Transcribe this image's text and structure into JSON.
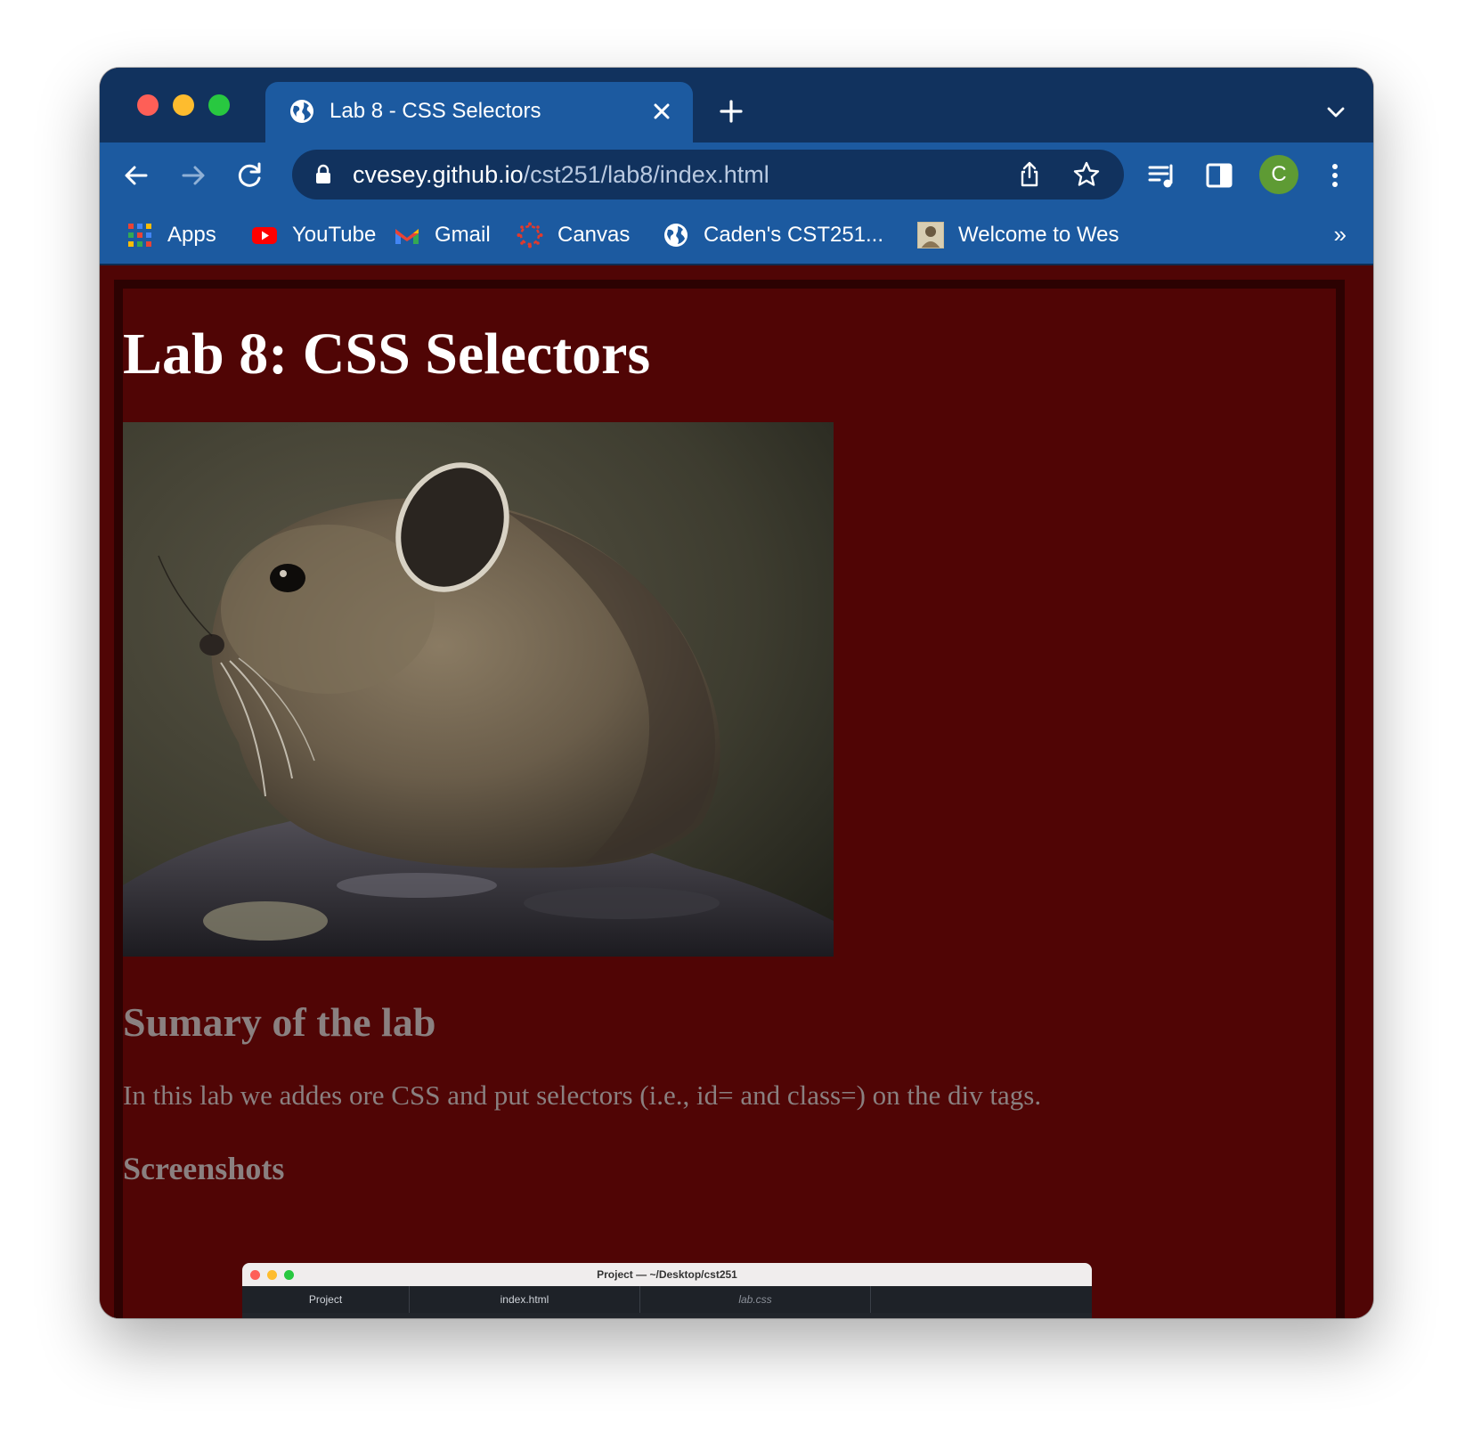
{
  "browser": {
    "tab_title": "Lab 8 - CSS Selectors",
    "url_host": "cvesey.github.io",
    "url_path": "/cst251/lab8/index.html",
    "profile_initial": "C",
    "bookmarks": [
      {
        "label": "Apps",
        "icon": "apps-grid-icon"
      },
      {
        "label": "YouTube",
        "icon": "youtube-icon"
      },
      {
        "label": "Gmail",
        "icon": "gmail-icon"
      },
      {
        "label": "Canvas",
        "icon": "canvas-icon"
      },
      {
        "label": "Caden's CST251...",
        "icon": "globe-icon"
      },
      {
        "label": "Welcome to Wes",
        "icon": "site-thumbnail-icon"
      }
    ],
    "bookmarks_overflow": "»",
    "colors": {
      "tabstrip": "#11325e",
      "toolbar": "#1c5aa0",
      "avatar": "#5e9b34"
    }
  },
  "page": {
    "title": "Lab 8: CSS Selectors",
    "summary_heading": "Sumary of the lab",
    "summary_text": "In this lab we addes ore CSS and put selectors (i.e., id= and class=) on the div tags.",
    "screenshots_heading": "Screenshots",
    "background_color": "#500505",
    "photo_subject": "pika on a rock",
    "embedded_screenshot": {
      "window_title": "Project — ~/Desktop/cst251",
      "tabs": [
        "Project",
        "index.html",
        "lab.css"
      ]
    }
  }
}
